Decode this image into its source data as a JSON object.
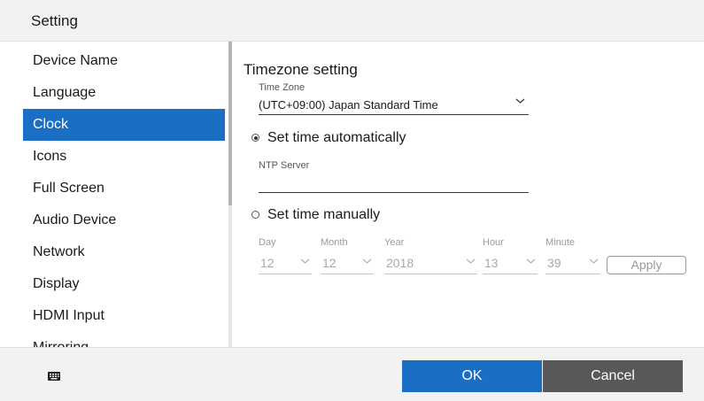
{
  "window": {
    "title": "Setting"
  },
  "sidebar": {
    "items": [
      {
        "label": "Device Name"
      },
      {
        "label": "Language"
      },
      {
        "label": "Clock",
        "selected": true
      },
      {
        "label": "Icons"
      },
      {
        "label": "Full Screen"
      },
      {
        "label": "Audio Device"
      },
      {
        "label": "Network"
      },
      {
        "label": "Display"
      },
      {
        "label": "HDMI Input"
      },
      {
        "label": "Mirroring"
      }
    ]
  },
  "clock": {
    "heading": "Timezone setting",
    "timezone": {
      "label": "Time Zone",
      "value": "(UTC+09:00) Japan Standard Time",
      "icon": "chevron-down-icon"
    },
    "auto": {
      "label": "Set time automatically",
      "checked": true
    },
    "ntp": {
      "label": "NTP Server",
      "value": ""
    },
    "manual": {
      "label": "Set time manually",
      "checked": false,
      "fields": [
        {
          "label": "Day",
          "value": "12"
        },
        {
          "label": "Month",
          "value": "12"
        },
        {
          "label": "Year",
          "value": "2018"
        },
        {
          "label": "Hour",
          "value": "13"
        },
        {
          "label": "Minute",
          "value": "39"
        }
      ],
      "apply_label": "Apply"
    }
  },
  "footer": {
    "keyboard_icon": "keyboard-icon",
    "ok_label": "OK",
    "cancel_label": "Cancel"
  },
  "colors": {
    "accent": "#1a6fc4",
    "cancel": "#585858",
    "bar": "#f2f2f2"
  }
}
